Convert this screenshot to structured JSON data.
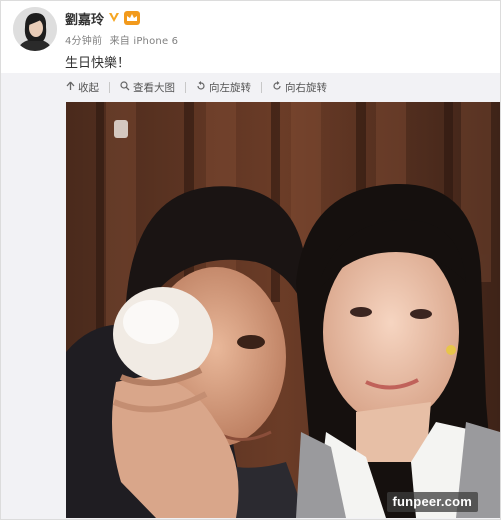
{
  "post": {
    "author": {
      "name": "劉嘉玲",
      "verified_icon": "verified-v-icon",
      "badge_icon": "vip-crown-icon"
    },
    "time": "4分钟前",
    "source": "来自 iPhone 6",
    "text": "生日快樂！"
  },
  "toolbar": {
    "collapse": {
      "icon": "arrow-up-icon",
      "label": "收起"
    },
    "view_large": {
      "icon": "magnifier-icon",
      "label": "查看大图"
    },
    "rotate_left": {
      "icon": "rotate-left-icon",
      "label": "向左旋转"
    },
    "rotate_right": {
      "icon": "rotate-right-icon",
      "label": "向右旋转"
    }
  },
  "image": {
    "watermark": "funpeer.com"
  },
  "colors": {
    "accent": "#f29a1c",
    "meta_text": "#808080",
    "toolbar_bg": "#f2f2f5"
  }
}
